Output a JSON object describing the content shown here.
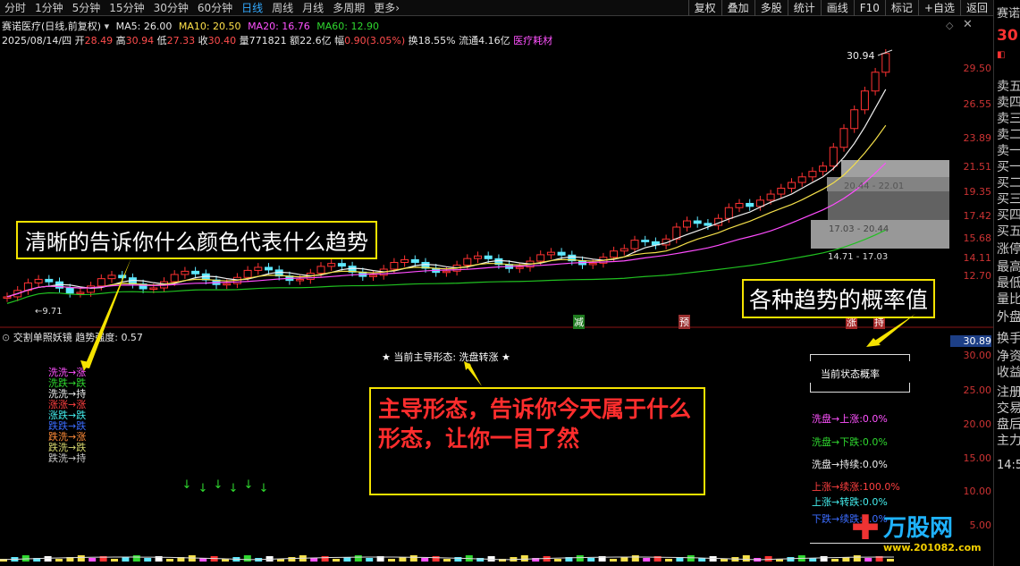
{
  "toolbar": {
    "tabs": [
      "分时",
      "1分钟",
      "5分钟",
      "15分钟",
      "30分钟",
      "60分钟",
      "日线",
      "周线",
      "月线",
      "多周期",
      "更多"
    ],
    "active_tab": "日线",
    "more_chevron": "›",
    "tools": [
      "复权",
      "叠加",
      "多股",
      "统计",
      "画线",
      "F10",
      "标记",
      "+自选",
      "返回"
    ]
  },
  "header": {
    "title": "赛诺医疗(日线,前复权)",
    "ma5": "MA5: 26.00",
    "ma10": "MA10: 20.50",
    "ma20": "MA20: 16.76",
    "ma60": "MA60: 12.90",
    "date": "2025/08/14/四",
    "open_label": "开",
    "open": "28.49",
    "high_label": "高",
    "high": "30.94",
    "low_label": "低",
    "low": "27.33",
    "close_label": "收",
    "close": "30.40",
    "vol_label": "量",
    "vol": "771821",
    "amt_label": "额",
    "amt": "22.6亿",
    "chg_label": "幅",
    "chg": "0.90(3.05%)",
    "turnover": "换18.55%",
    "float_cap": "流通4.16亿",
    "sector": "医疗耗材"
  },
  "price_axis": [
    "29.50",
    "26.55",
    "23.89",
    "21.51",
    "19.35",
    "17.42",
    "15.68",
    "14.11",
    "12.70"
  ],
  "price_axis_highlight": "30.89",
  "indicator_axis": [
    "30.00",
    "25.00",
    "20.00",
    "15.00",
    "10.00",
    "5.00"
  ],
  "chart_annotations": {
    "high_price": "30.94",
    "low_price": "9.71",
    "chip_box_1": "20.44 - 22.01",
    "chip_box_2": "17.03 - 20.44",
    "chip_box_3": "14.71 - 17.03",
    "tag_reduce": "减",
    "tag_pre": "预",
    "tag_rise": "涨",
    "tag_hold": "持"
  },
  "indicator": {
    "name": "交割单照妖镜",
    "strength_label": "趋势强度:",
    "strength": "0.57",
    "main_form": "★ 当前主导形态: 洗盘转涨 ★",
    "legend": [
      {
        "text": "洗洗→涨",
        "color": "#ff52ff"
      },
      {
        "text": "洗跌→跌",
        "color": "#2fd72f"
      },
      {
        "text": "洗洗→持",
        "color": "#f0f0f0"
      },
      {
        "text": "涨涨→涨",
        "color": "#ff4040"
      },
      {
        "text": "涨跌→跌",
        "color": "#4ee"
      },
      {
        "text": "跌跌→跌",
        "color": "#3b6cff"
      },
      {
        "text": "跌洗→涨",
        "color": "#ff8c3a"
      },
      {
        "text": "跌洗→跌",
        "color": "#d8d870"
      },
      {
        "text": "跌洗→持",
        "color": "#c8c8c8"
      }
    ]
  },
  "prob_panel": {
    "title": "当前状态概率",
    "rows": [
      {
        "text": "洗盘→上涨:0.0%",
        "color": "#ff52ff"
      },
      {
        "text": "洗盘→下跌:0.0%",
        "color": "#2fd72f"
      },
      {
        "text": "洗盘→持续:0.0%",
        "color": "#f0f0f0"
      },
      {
        "text": "上涨→续涨:100.0%",
        "color": "#ff4040"
      },
      {
        "text": "上涨→转跌:0.0%",
        "color": "#4ee"
      },
      {
        "text": "下跌→续跌:0.0%",
        "color": "#3b6cff"
      }
    ]
  },
  "callouts": {
    "top_left": "清晰的告诉你什么颜色代表什么趋势",
    "top_right": "各种趋势的概率值",
    "middle": "主导形态，告诉你今天属于什么形态，让你一目了然"
  },
  "right_panel": {
    "stock_short": "赛诺",
    "price": "30",
    "items": [
      "卖五",
      "卖四",
      "卖三",
      "卖二",
      "卖一",
      "买一",
      "买二",
      "买三",
      "买四",
      "买五",
      "涨停",
      "最高",
      "最低",
      "量比",
      "外盘",
      "换手",
      "净资",
      "收益",
      "注册",
      "交易",
      "盘后",
      "主力"
    ],
    "time": "14:5"
  },
  "watermark": {
    "brand": "万股网",
    "url": "www.201082.com"
  },
  "colors": {
    "up": "#ff3232",
    "down": "#2fd72f",
    "cyan": "#5fe8ff",
    "callout_border": "#f5e300",
    "bg": "#000000"
  }
}
